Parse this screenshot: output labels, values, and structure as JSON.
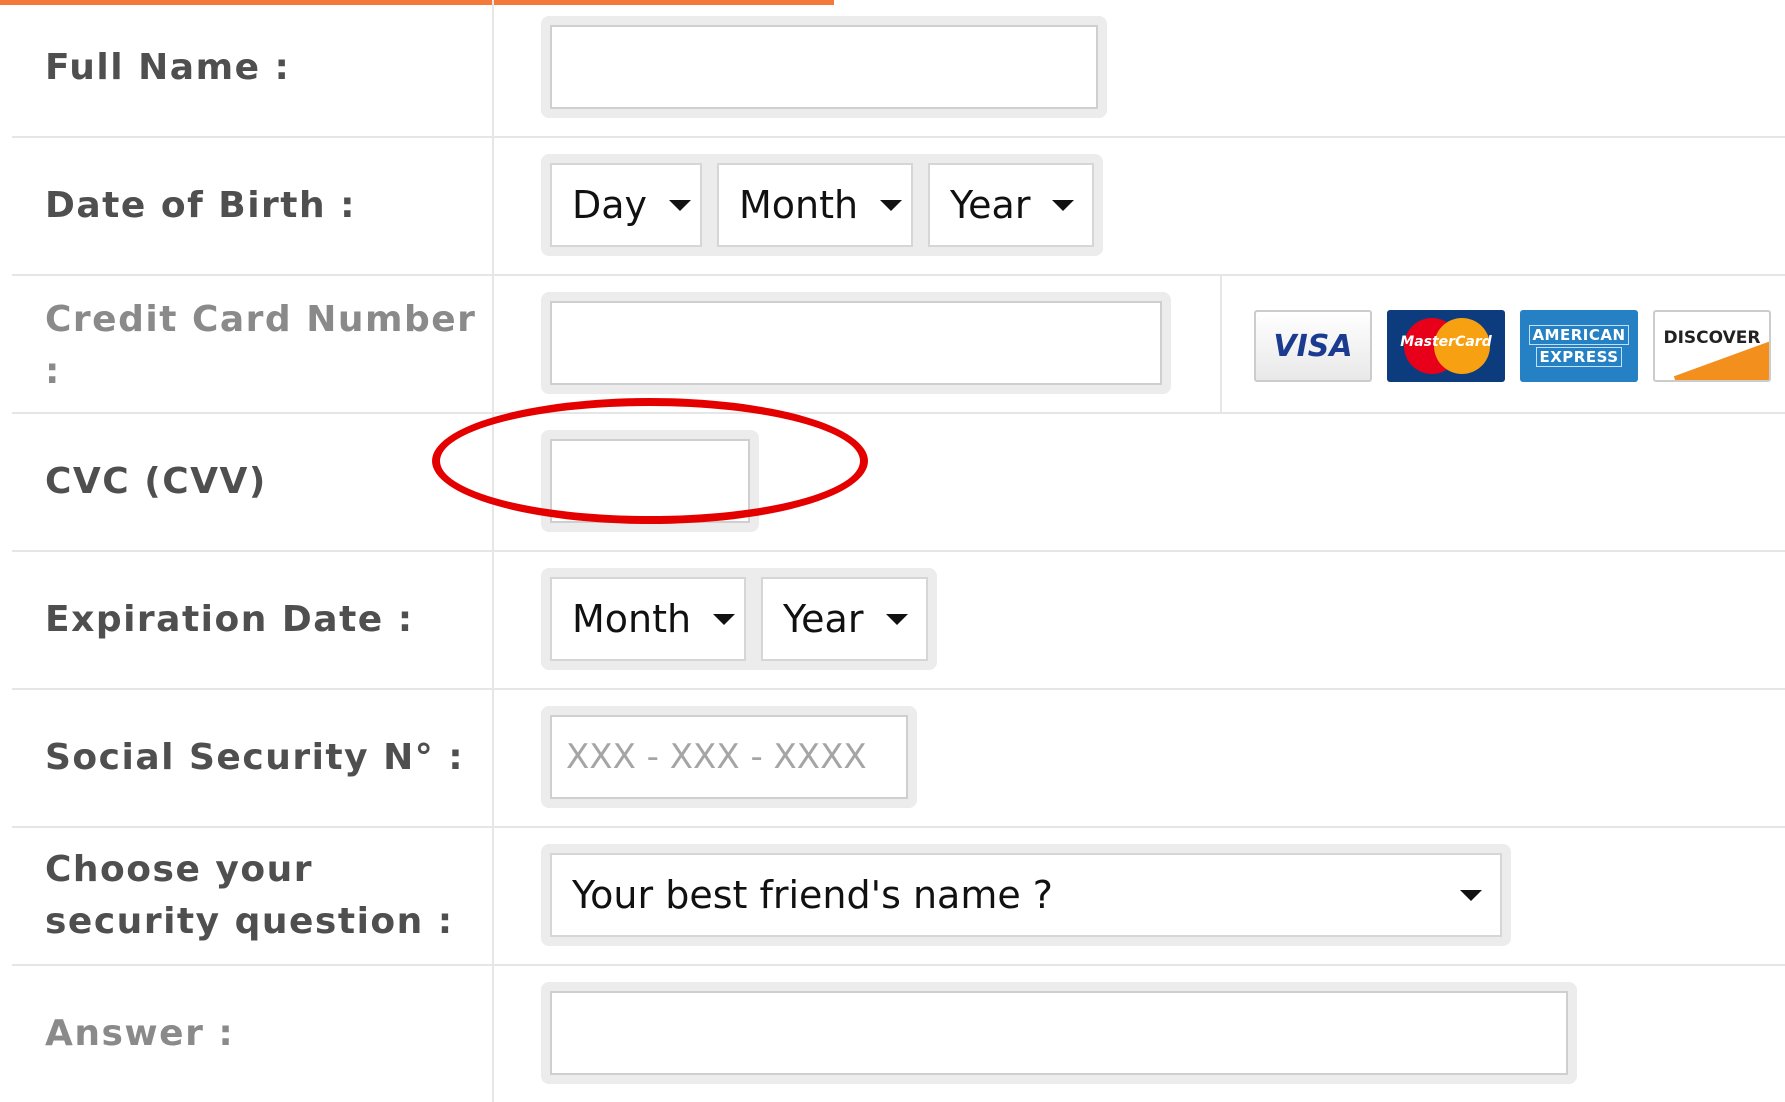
{
  "form": {
    "full_name": {
      "label": "Full Name :",
      "value": ""
    },
    "dob": {
      "label": "Date of Birth :",
      "day": "Day",
      "month": "Month",
      "year": "Year"
    },
    "card_number": {
      "label": "Credit Card Number :",
      "value": ""
    },
    "card_logos": {
      "visa": "VISA",
      "mastercard": "MasterCard",
      "amex_line1": "AMERICAN",
      "amex_line2": "EXPRESS",
      "discover": "DISCOVER"
    },
    "cvc": {
      "label": "CVC (CVV)",
      "value": ""
    },
    "expiration": {
      "label": "Expiration Date :",
      "month": "Month",
      "year": "Year"
    },
    "ssn": {
      "label": "Social Security N° :",
      "placeholder": "XXX - XXX - XXXX"
    },
    "security_question": {
      "label": "Choose your security question :",
      "selected": "Your best friend's name ?"
    },
    "answer": {
      "label": "Answer :",
      "value": ""
    }
  },
  "colors": {
    "accent_bar": "#f47a3c",
    "highlight": "#e50000"
  },
  "annotation": {
    "shape": "ellipse",
    "target": "cvc-input"
  }
}
